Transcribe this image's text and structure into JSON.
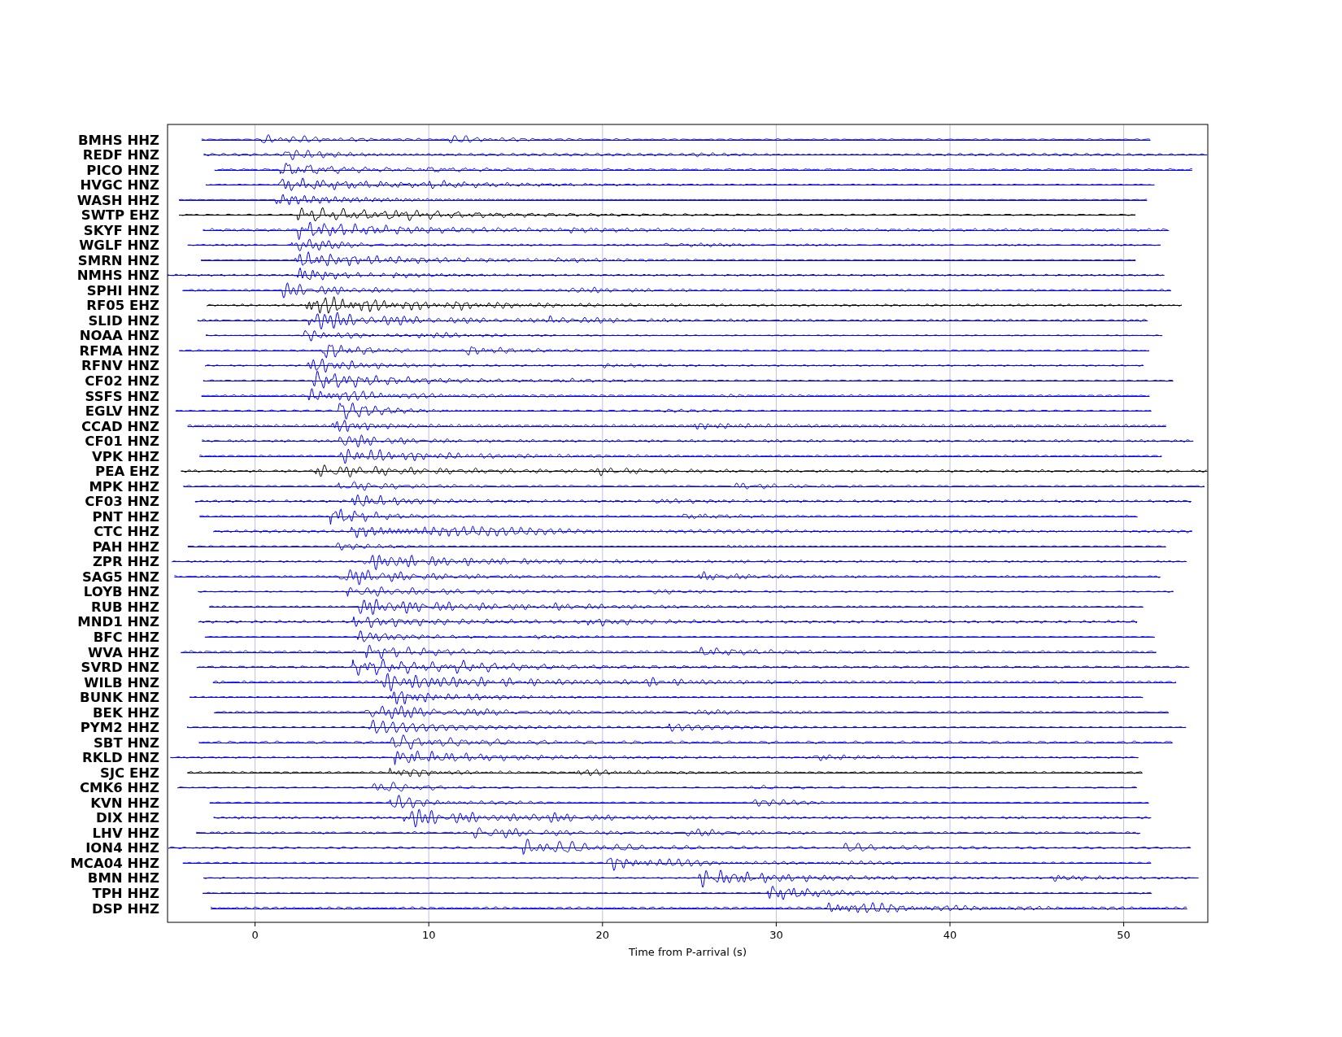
{
  "figure": {
    "xlabel": "Time from P-arrival (s)",
    "xticks": [
      "0",
      "10",
      "20",
      "30",
      "40",
      "50"
    ],
    "traces": [
      {
        "label": "BMHS HHZ",
        "color": "#0000ff"
      },
      {
        "label": "REDF HNZ",
        "color": "#0000ff"
      },
      {
        "label": "PICO HNZ",
        "color": "#0000ff"
      },
      {
        "label": "HVGC HNZ",
        "color": "#0000ff"
      },
      {
        "label": "WASH HHZ",
        "color": "#0000ff"
      },
      {
        "label": "SWTP EHZ",
        "color": "#000000"
      },
      {
        "label": "SKYF HNZ",
        "color": "#0000ff"
      },
      {
        "label": "WGLF HNZ",
        "color": "#0000ff"
      },
      {
        "label": "SMRN HNZ",
        "color": "#0000ff"
      },
      {
        "label": "NMHS HNZ",
        "color": "#0000ff"
      },
      {
        "label": "SPHI HNZ",
        "color": "#0000ff"
      },
      {
        "label": "RF05 EHZ",
        "color": "#000000"
      },
      {
        "label": "SLID HNZ",
        "color": "#0000ff"
      },
      {
        "label": "NOAA HNZ",
        "color": "#0000ff"
      },
      {
        "label": "RFMA HNZ",
        "color": "#0000ff"
      },
      {
        "label": "RFNV HNZ",
        "color": "#0000ff"
      },
      {
        "label": "CF02 HNZ",
        "color": "#0000ff"
      },
      {
        "label": "SSFS HNZ",
        "color": "#0000ff"
      },
      {
        "label": "EGLV HNZ",
        "color": "#0000ff"
      },
      {
        "label": "CCAD HNZ",
        "color": "#0000ff"
      },
      {
        "label": "CF01 HNZ",
        "color": "#0000ff"
      },
      {
        "label": "VPK HHZ",
        "color": "#0000ff"
      },
      {
        "label": "PEA EHZ",
        "color": "#000000"
      },
      {
        "label": "MPK HHZ",
        "color": "#0000ff"
      },
      {
        "label": "CF03 HNZ",
        "color": "#0000ff"
      },
      {
        "label": "PNT HHZ",
        "color": "#0000ff"
      },
      {
        "label": "CTC HHZ",
        "color": "#0000ff"
      },
      {
        "label": "PAH HHZ",
        "color": "#0000ff"
      },
      {
        "label": "ZPR HHZ",
        "color": "#0000ff"
      },
      {
        "label": "SAG5 HNZ",
        "color": "#0000ff"
      },
      {
        "label": "LOYB HNZ",
        "color": "#0000ff"
      },
      {
        "label": "RUB HHZ",
        "color": "#0000ff"
      },
      {
        "label": "MND1 HNZ",
        "color": "#0000ff"
      },
      {
        "label": "BFC HHZ",
        "color": "#0000ff"
      },
      {
        "label": "WVA HHZ",
        "color": "#0000ff"
      },
      {
        "label": "SVRD HNZ",
        "color": "#0000ff"
      },
      {
        "label": "WILB HNZ",
        "color": "#0000ff"
      },
      {
        "label": "BUNK HNZ",
        "color": "#0000ff"
      },
      {
        "label": "BEK HHZ",
        "color": "#0000ff"
      },
      {
        "label": "PYM2 HHZ",
        "color": "#0000ff"
      },
      {
        "label": "SBT HNZ",
        "color": "#0000ff"
      },
      {
        "label": "RKLD HNZ",
        "color": "#0000ff"
      },
      {
        "label": "SJC EHZ",
        "color": "#000000"
      },
      {
        "label": "CMK6 HHZ",
        "color": "#0000ff"
      },
      {
        "label": "KVN HHZ",
        "color": "#0000ff"
      },
      {
        "label": "DIX HHZ",
        "color": "#0000ff"
      },
      {
        "label": "LHV HHZ",
        "color": "#0000ff"
      },
      {
        "label": "ION4 HHZ",
        "color": "#0000ff"
      },
      {
        "label": "MCA04 HHZ",
        "color": "#0000ff"
      },
      {
        "label": "BMN HHZ",
        "color": "#0000ff"
      },
      {
        "label": "TPH HHZ",
        "color": "#0000ff"
      },
      {
        "label": "DSP HHZ",
        "color": "#0000ff"
      }
    ]
  }
}
